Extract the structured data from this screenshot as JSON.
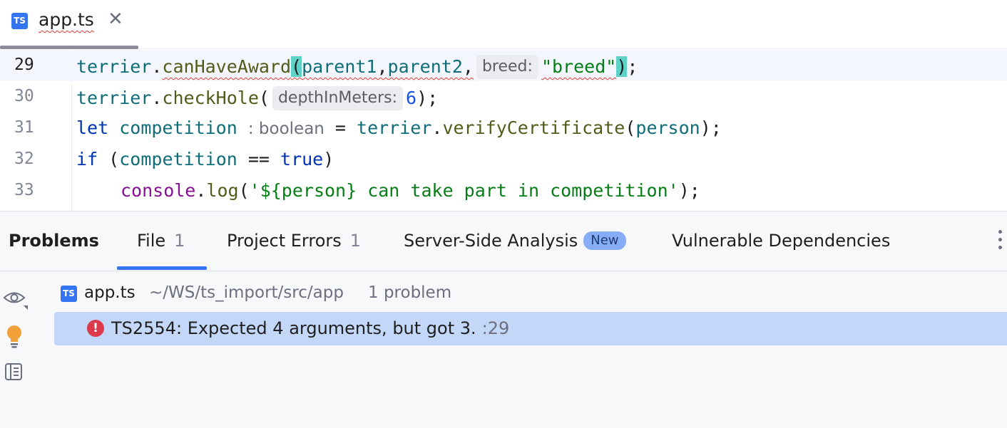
{
  "tab": {
    "badge": "TS",
    "file_name": "app.ts",
    "close_glyph": "✕"
  },
  "editor": {
    "lines": [
      {
        "number": "29"
      },
      {
        "number": "30"
      },
      {
        "number": "31"
      },
      {
        "number": "32"
      },
      {
        "number": "33"
      }
    ],
    "tokens": {
      "terrier": "terrier",
      "dot": ".",
      "canHaveAward": "canHaveAward",
      "open_paren": "(",
      "close_paren": ")",
      "semicolon": ";",
      "parent1": "parent1",
      "comma": ",",
      "parent2": "parent2",
      "hint_breed": "breed:",
      "breed_str": "\"breed\"",
      "checkHole": "checkHole",
      "hint_depth": "depthInMeters:",
      "six": "6",
      "let": "let",
      "competition": "competition",
      "type_hint": ": boolean",
      "equals": " = ",
      "verifyCertificate": "verifyCertificate",
      "person": "person",
      "if": "if",
      "space": " ",
      "eqeq": " == ",
      "true": "true",
      "console": "console",
      "log": "log",
      "log_str": "'${person} can take part in competition'"
    }
  },
  "problems": {
    "title": "Problems",
    "tabs": [
      {
        "label": "File",
        "count": "1"
      },
      {
        "label": "Project Errors",
        "count": "1"
      },
      {
        "label": "Server-Side Analysis",
        "badge": "New"
      },
      {
        "label": "Vulnerable Dependencies"
      }
    ],
    "file": {
      "badge": "TS",
      "name": "app.ts",
      "path": "~/WS/ts_import/src/app",
      "count": "1 problem"
    },
    "items": [
      {
        "message": "TS2554: Expected 4 arguments, but got 3.",
        "line": ":29"
      }
    ]
  },
  "colors": {
    "accent": "#3574f0",
    "error": "#db3b4b",
    "selection": "#c3d7f9",
    "bracket_highlight": "#5fd2c8"
  },
  "icons": [
    "close-icon",
    "eye-icon",
    "lightbulb-icon",
    "preview-panel-icon",
    "more-vertical-icon",
    "error-icon"
  ]
}
